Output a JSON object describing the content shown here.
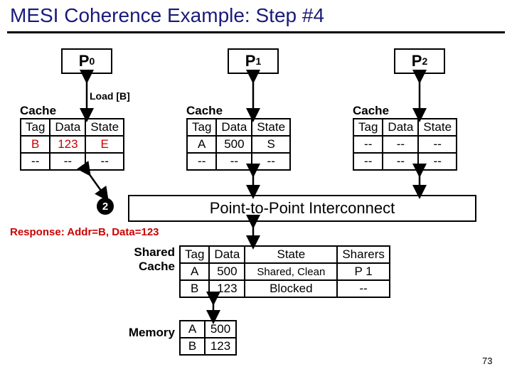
{
  "title": "MESI Coherence Example: Step #4",
  "page_number": "73",
  "processors": {
    "p0": "P",
    "p0_sub": "0",
    "p1": "P",
    "p1_sub": "1",
    "p2": "P",
    "p2_sub": "2"
  },
  "load_action": "Load [B]",
  "cache_label": "Cache",
  "headers": {
    "tag": "Tag",
    "data": "Data",
    "state": "State",
    "sharers": "Sharers"
  },
  "cache0": {
    "r0": {
      "tag": "B",
      "data": "123",
      "state": "E"
    },
    "r1": {
      "tag": "--",
      "data": "--",
      "state": "--"
    }
  },
  "cache1": {
    "r0": {
      "tag": "A",
      "data": "500",
      "state": "S"
    },
    "r1": {
      "tag": "--",
      "data": "--",
      "state": "--"
    }
  },
  "cache2": {
    "r0": {
      "tag": "--",
      "data": "--",
      "state": "--"
    },
    "r1": {
      "tag": "--",
      "data": "--",
      "state": "--"
    }
  },
  "step_bubble": "2",
  "interconnect_label": "Point-to-Point Interconnect",
  "response_label": "Response: Addr=B, Data=123",
  "shared_cache_label_a": "Shared",
  "shared_cache_label_b": "Cache",
  "shared_cache": {
    "r0": {
      "tag": "A",
      "data": "500",
      "state": "Shared, Clean",
      "sharers": "P 1"
    },
    "r1": {
      "tag": "B",
      "data": "123",
      "state": "Blocked",
      "sharers": "--"
    }
  },
  "memory_label": "Memory",
  "memory": {
    "r0": {
      "tag": "A",
      "data": "500"
    },
    "r1": {
      "tag": "B",
      "data": "123"
    }
  }
}
